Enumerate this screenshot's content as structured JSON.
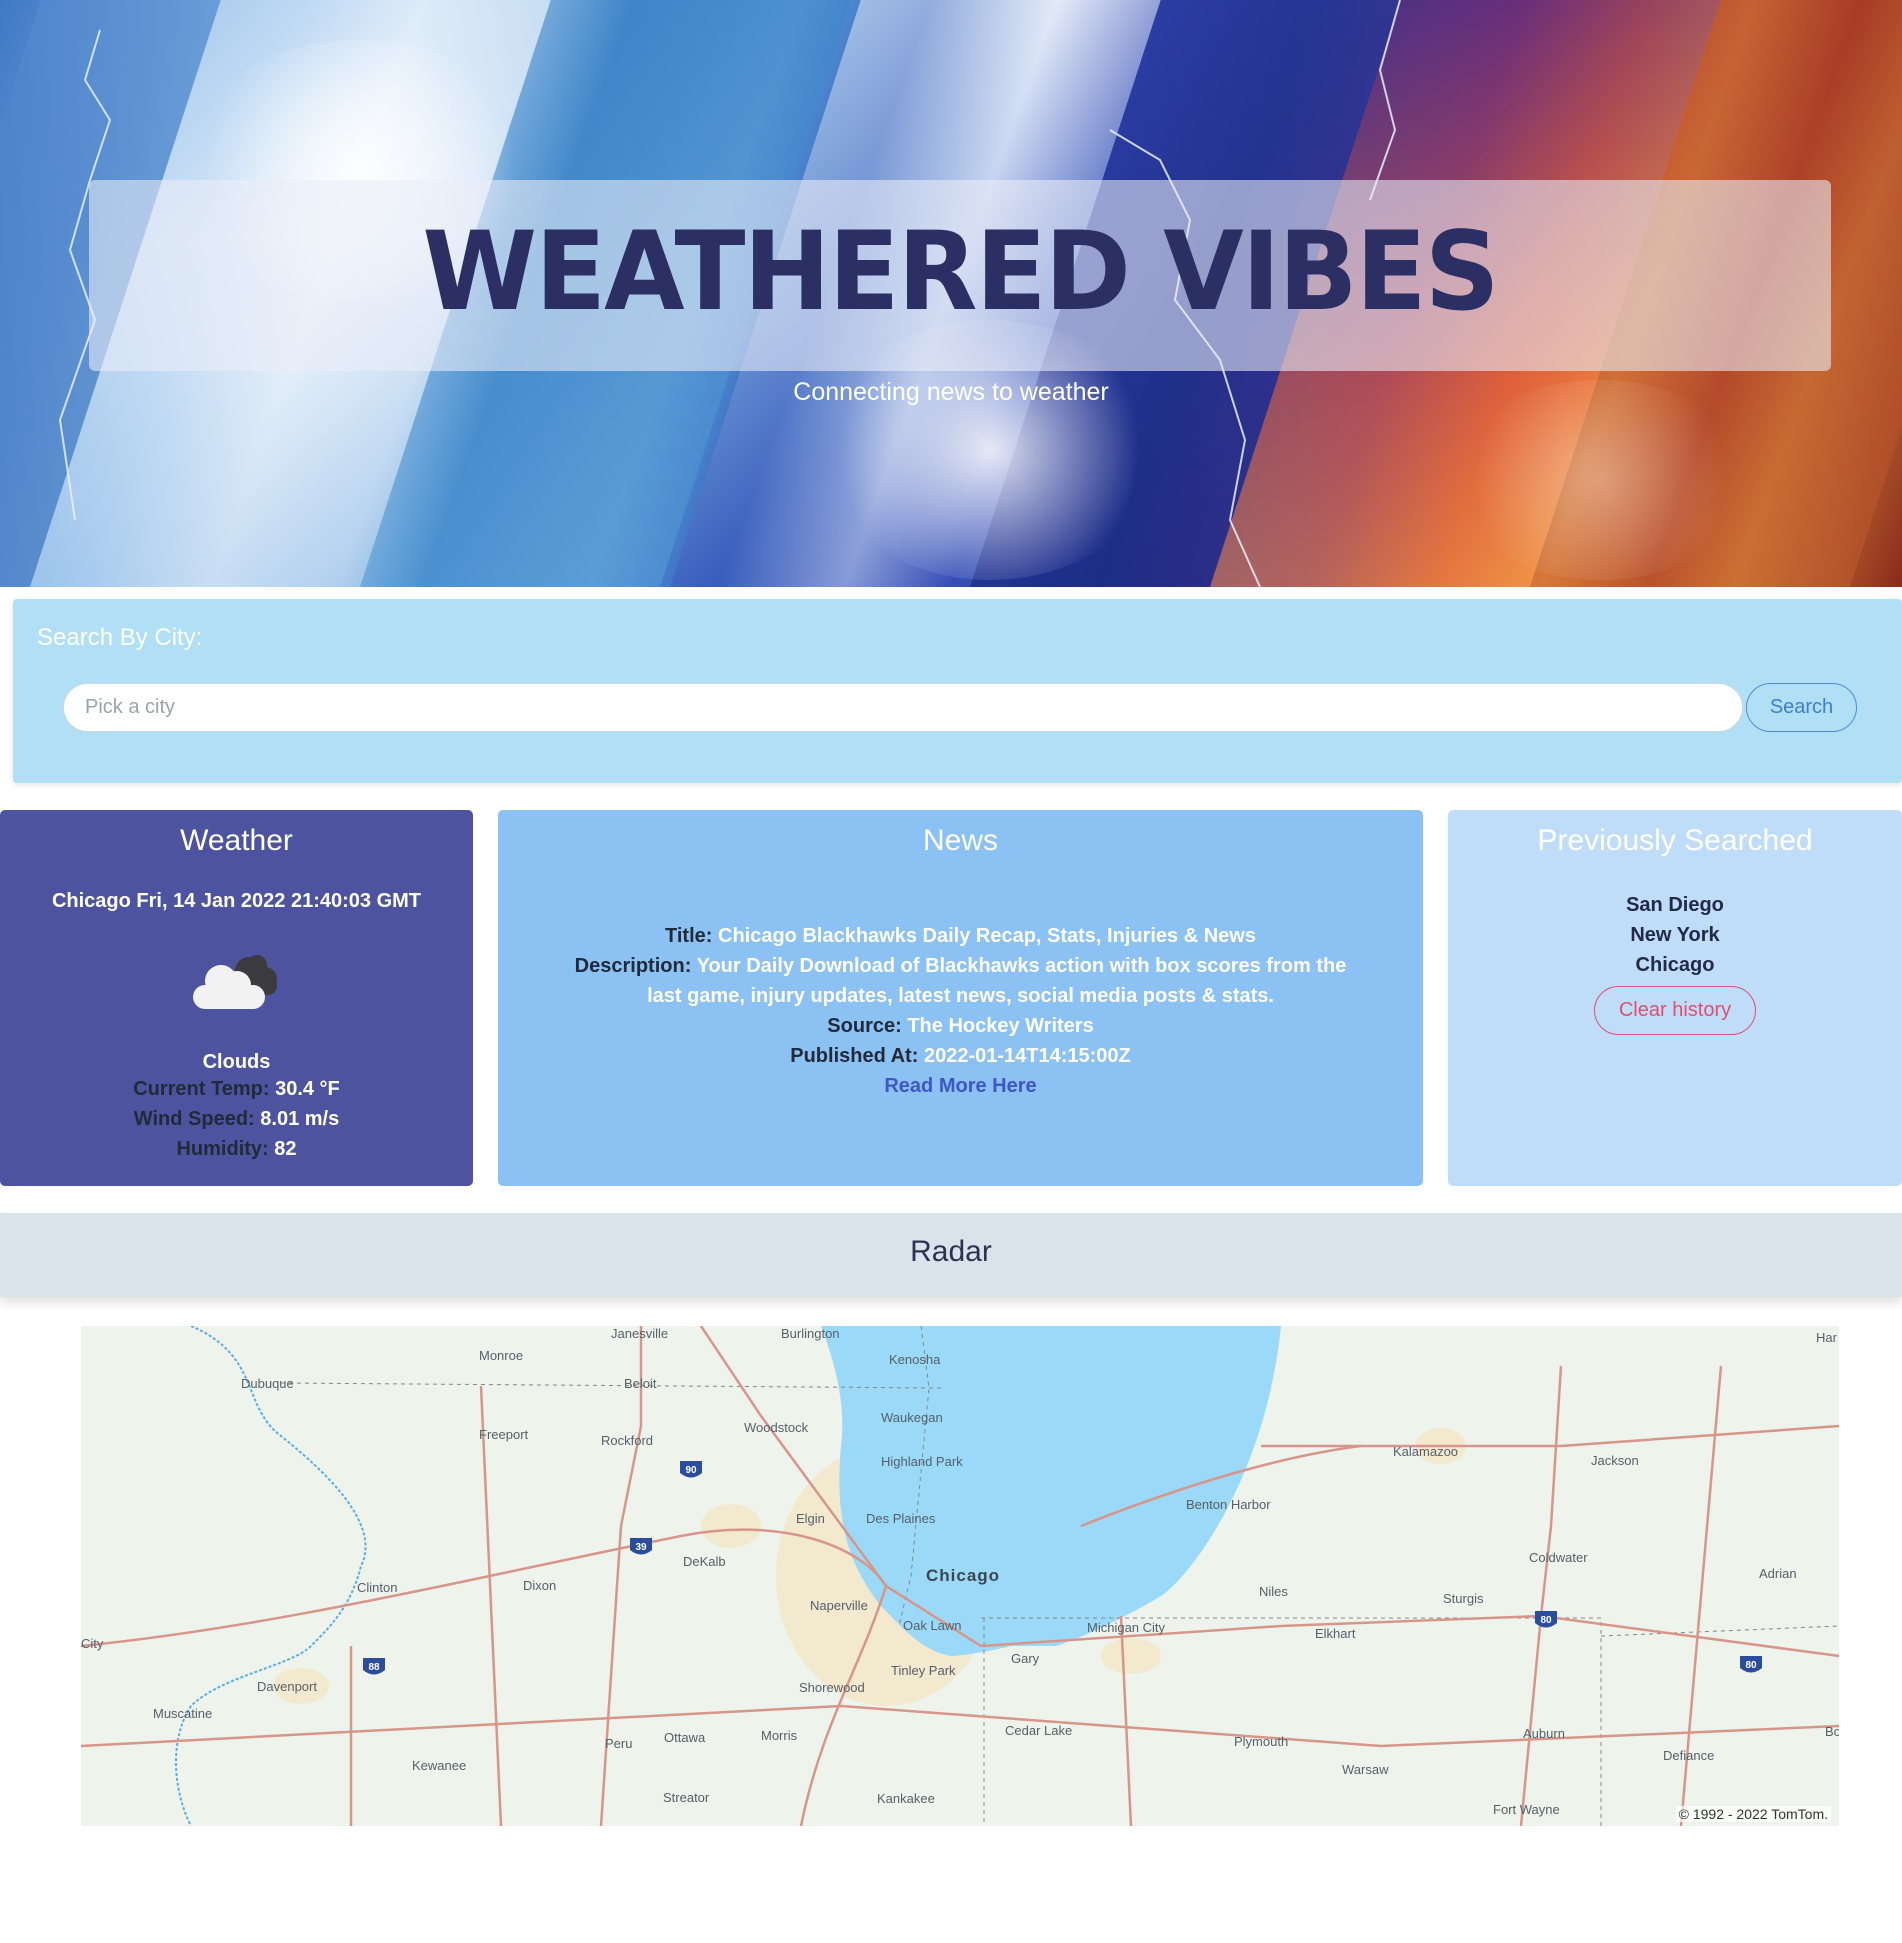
{
  "header": {
    "title": "WEATHERED VIBES",
    "tagline": "Connecting news to weather"
  },
  "search": {
    "label": "Search By City:",
    "placeholder": "Pick a city",
    "button_label": "Search"
  },
  "weather": {
    "title": "Weather",
    "city_datetime": "Chicago Fri, 14 Jan 2022 21:40:03 GMT",
    "icon": "cloud-icon",
    "condition": "Clouds",
    "temp_label": "Current Temp:",
    "temp_value": "30.4 °F",
    "wind_label": "Wind Speed:",
    "wind_value": "8.01 m/s",
    "humidity_label": "Humidity:",
    "humidity_value": "82"
  },
  "news": {
    "title": "News",
    "title_label": "Title:",
    "title_value": "Chicago Blackhawks Daily Recap, Stats, Injuries & News",
    "description_label": "Description:",
    "description_value": "Your Daily Download of Blackhawks action with box scores from the last game, injury updates, latest news, social media posts & stats.",
    "source_label": "Source:",
    "source_value": "The Hockey Writers",
    "published_label": "Published At:",
    "published_value": "2022-01-14T14:15:00Z",
    "link_label": "Read More Here"
  },
  "history": {
    "title": "Previously Searched",
    "cities": [
      "San Diego",
      "New York",
      "Chicago"
    ],
    "clear_label": "Clear history"
  },
  "radar": {
    "title": "Radar",
    "copyright": "© 1992 - 2022 TomTom.",
    "labels": [
      "Janesville",
      "Burlington",
      "Monroe",
      "Kenosha",
      "Dubuque",
      "Beloit",
      "Waukegan",
      "Woodstock",
      "Freeport",
      "Rockford",
      "Highland Park",
      "Kalamazoo",
      "Jackson",
      "Benton Harbor",
      "Elgin",
      "Des Plaines",
      "DeKalb",
      "Chicago",
      "Coldwater",
      "Adrian",
      "Clinton",
      "Dixon",
      "Niles",
      "Sturgis",
      "Naperville",
      "Oak Lawn",
      "Michigan City",
      "Elkhart",
      "City",
      "Tinley Park",
      "Gary",
      "Davenport",
      "Shorewood",
      "Muscatine",
      "Cedar Lake",
      "Auburn",
      "Peru",
      "Ottawa",
      "Morris",
      "Plymouth",
      "Defiance",
      "Kewanee",
      "Warsaw",
      "Streator",
      "Kankakee",
      "Fort Wayne",
      "Har",
      "Bo"
    ],
    "highway_shields": [
      "90",
      "39",
      "88",
      "80",
      "80"
    ]
  },
  "colors": {
    "weather_card": "#4e53a0",
    "news_card": "#8cc1f4",
    "history_card": "#bfddf8",
    "search_panel": "#b1dff5",
    "title_text": "#2c2f63",
    "lake": "#9ad9f8"
  }
}
